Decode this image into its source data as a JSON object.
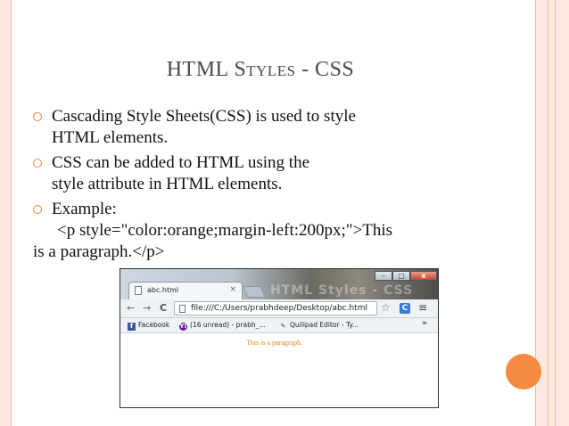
{
  "slide": {
    "title_first_letter": "HTML S",
    "title_smallcaps": "tyles",
    "title_rest": " - CSS",
    "bullets": [
      {
        "lines": [
          "Cascading Style Sheets(CSS) is used to style",
          "HTML elements."
        ]
      },
      {
        "lines": [
          "CSS can be added to HTML using the",
          "style attribute in HTML elements."
        ]
      },
      {
        "lines": [
          "Example:"
        ],
        "code": "<p style=\"color:orange;margin-left:200px;\">This",
        "code_cont": "is a paragraph.</p>"
      }
    ]
  },
  "browser": {
    "tab_title": "abc.html",
    "tab_close": "×",
    "watermark": "HTML Styles - CSS",
    "window_buttons": [
      "–",
      "□",
      "x"
    ],
    "nav": {
      "back": "←",
      "forward": "→",
      "reload": "C"
    },
    "address": "file:///C:/Users/prabhdeep/Desktop/abc.html",
    "star": "☆",
    "extension": "C",
    "menu": "≡",
    "bookmarks": [
      {
        "icon": "f",
        "label": "Facebook"
      },
      {
        "icon": "Y!",
        "label": "(16 unread) - prabh_..."
      },
      {
        "icon": "✎",
        "label": "Quillpad Editor - Ty..."
      }
    ],
    "bookmarks_more": "»",
    "paragraph": "This is a paragraph."
  },
  "colors": {
    "accent": "#f58a42",
    "frame": "#fde9e2",
    "paragraph": "#e08a1e"
  }
}
